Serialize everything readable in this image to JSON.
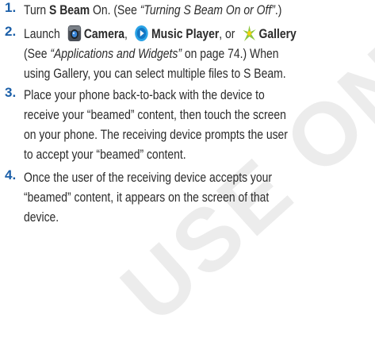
{
  "watermark": "USE ONLY",
  "steps": [
    {
      "num": "1.",
      "parts": [
        "Turn ",
        "S Beam",
        " On. (See ",
        "“Turning S Beam On or Off”",
        ".)"
      ]
    },
    {
      "num": "2.",
      "line1": [
        "Launch",
        "Camera",
        ",",
        "Music Player",
        ", or",
        "Gallery"
      ],
      "line2": [
        "(See ",
        "“Applications and Widgets”",
        " on page 74.) When"
      ],
      "line3": "using Gallery, you can select multiple files to S Beam."
    },
    {
      "num": "3.",
      "lines": [
        "Place your phone back-to-back with the device to",
        "receive your “beamed” content, then touch the screen",
        "on your phone. The receiving device prompts the user",
        "to accept your “beamed” content."
      ]
    },
    {
      "num": "4.",
      "lines": [
        "Once the user of the receiving device accepts your",
        "“beamed” content, it appears on the screen of that",
        "device."
      ]
    }
  ],
  "icons": [
    "camera-icon",
    "music-player-icon",
    "gallery-icon"
  ]
}
